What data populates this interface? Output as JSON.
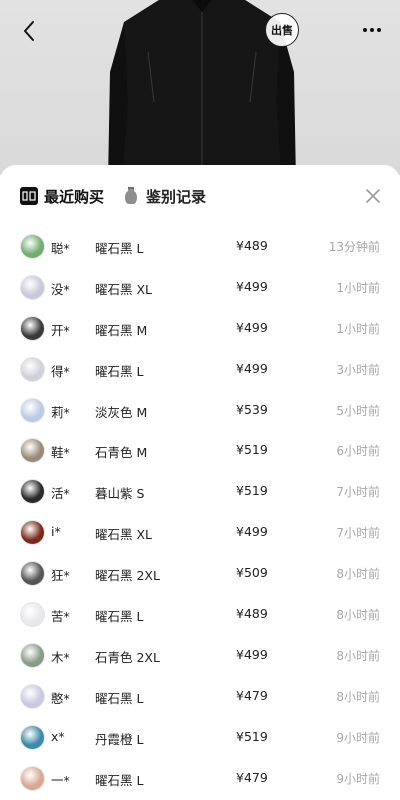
{
  "topbar": {
    "sell_label": "出售"
  },
  "tabs": [
    {
      "label": "最近购买",
      "icon": "brand-logo-icon",
      "active": true
    },
    {
      "label": "鉴别记录",
      "icon": "vase-icon",
      "active": false
    }
  ],
  "records": [
    {
      "user": "聪*",
      "color": "曜石黑 L",
      "price": "¥489",
      "time": "13分钟前",
      "avatar_color": "#6fae6f"
    },
    {
      "user": "没*",
      "color": "曜石黑 XL",
      "price": "¥499",
      "time": "1小时前",
      "avatar_color": "#c8c8d8"
    },
    {
      "user": "开*",
      "color": "曜石黑 M",
      "price": "¥499",
      "time": "1小时前",
      "avatar_color": "#3a3a3a"
    },
    {
      "user": "得*",
      "color": "曜石黑 L",
      "price": "¥499",
      "time": "3小时前",
      "avatar_color": "#d0d0d8"
    },
    {
      "user": "莉*",
      "color": "淡灰色 M",
      "price": "¥539",
      "time": "5小时前",
      "avatar_color": "#b9cbe6"
    },
    {
      "user": "鞋*",
      "color": "石青色 M",
      "price": "¥519",
      "time": "6小时前",
      "avatar_color": "#9a8a7a"
    },
    {
      "user": "活*",
      "color": "暮山紫 S",
      "price": "¥519",
      "time": "7小时前",
      "avatar_color": "#2a2a2a"
    },
    {
      "user": "i*",
      "color": "曜石黑 XL",
      "price": "¥499",
      "time": "7小时前",
      "avatar_color": "#7a2a1a"
    },
    {
      "user": "狂*",
      "color": "曜石黑 2XL",
      "price": "¥509",
      "time": "8小时前",
      "avatar_color": "#555555"
    },
    {
      "user": "苦*",
      "color": "曜石黑 L",
      "price": "¥489",
      "time": "8小时前",
      "avatar_color": "#e8e8ec"
    },
    {
      "user": "木*",
      "color": "石青色 2XL",
      "price": "¥499",
      "time": "8小时前",
      "avatar_color": "#8a9a8a"
    },
    {
      "user": "憨*",
      "color": "曜石黑 L",
      "price": "¥479",
      "time": "8小时前",
      "avatar_color": "#c8c8e0"
    },
    {
      "user": "x*",
      "color": "丹霞橙 L",
      "price": "¥519",
      "time": "9小时前",
      "avatar_color": "#3a8aa8"
    },
    {
      "user": "一*",
      "color": "曜石黑 L",
      "price": "¥479",
      "time": "9小时前",
      "avatar_color": "#d8a890"
    }
  ],
  "colors": {
    "time_text": "#a8a8a8",
    "primary_text": "#222222"
  }
}
